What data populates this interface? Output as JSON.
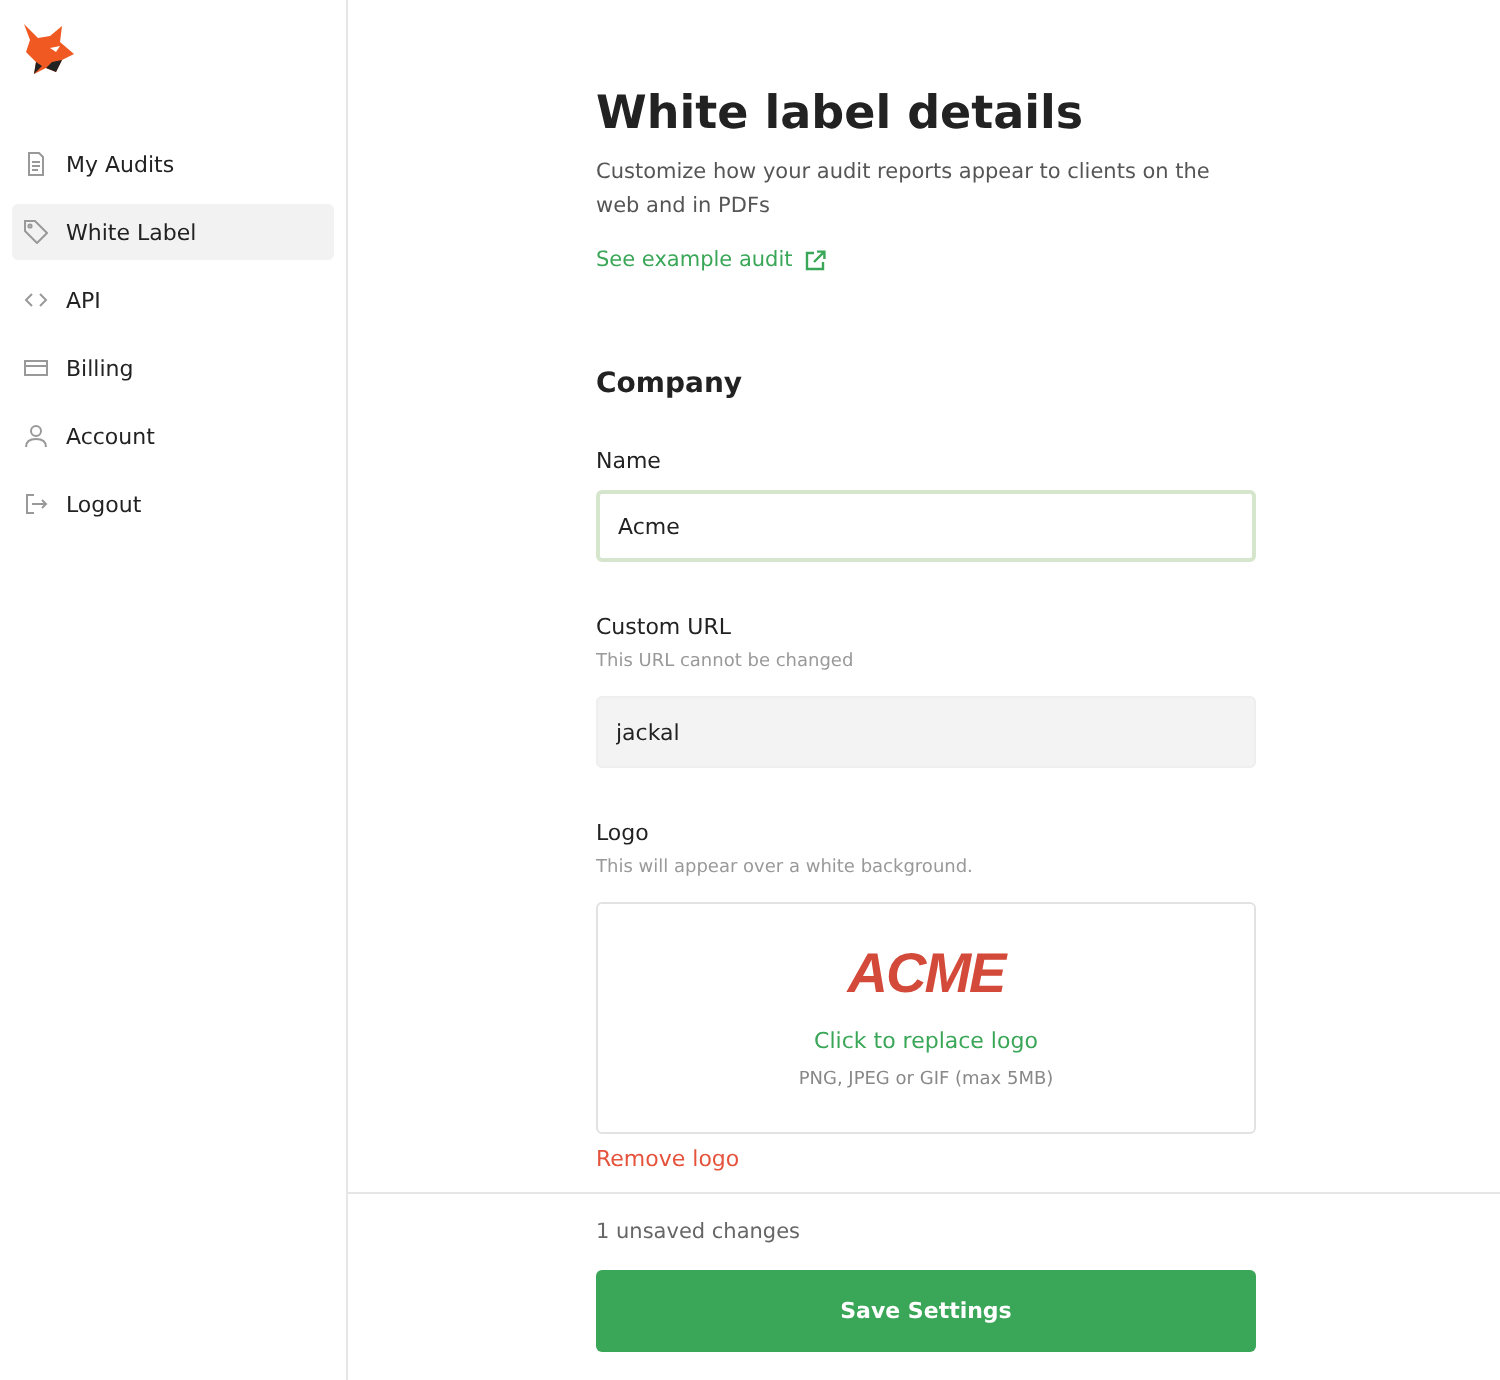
{
  "sidebar": {
    "items": [
      {
        "label": "My Audits",
        "selected": false
      },
      {
        "label": "White Label",
        "selected": true
      },
      {
        "label": "API",
        "selected": false
      },
      {
        "label": "Billing",
        "selected": false
      },
      {
        "label": "Account",
        "selected": false
      },
      {
        "label": "Logout",
        "selected": false
      }
    ]
  },
  "page": {
    "title": "White label details",
    "description": "Customize how your audit reports appear to clients on the web and in PDFs",
    "link": "See example audit"
  },
  "section": {
    "title": "Company"
  },
  "fields": [
    {
      "label": "Name",
      "value": "Acme",
      "disabled": false,
      "focused": true
    },
    {
      "label": "Custom URL",
      "hint": "This URL cannot be changed",
      "value": "jackal",
      "disabled": true,
      "focused": false
    }
  ],
  "logo": {
    "label": "Logo",
    "hint": "This will appear over a white background.",
    "logo_text": "ACME",
    "action": "Click to replace logo",
    "formats": "PNG, JPEG or GIF (max 5MB)",
    "remove": "Remove logo"
  },
  "footer": {
    "status": "1 unsaved changes",
    "button": "Save Settings"
  }
}
